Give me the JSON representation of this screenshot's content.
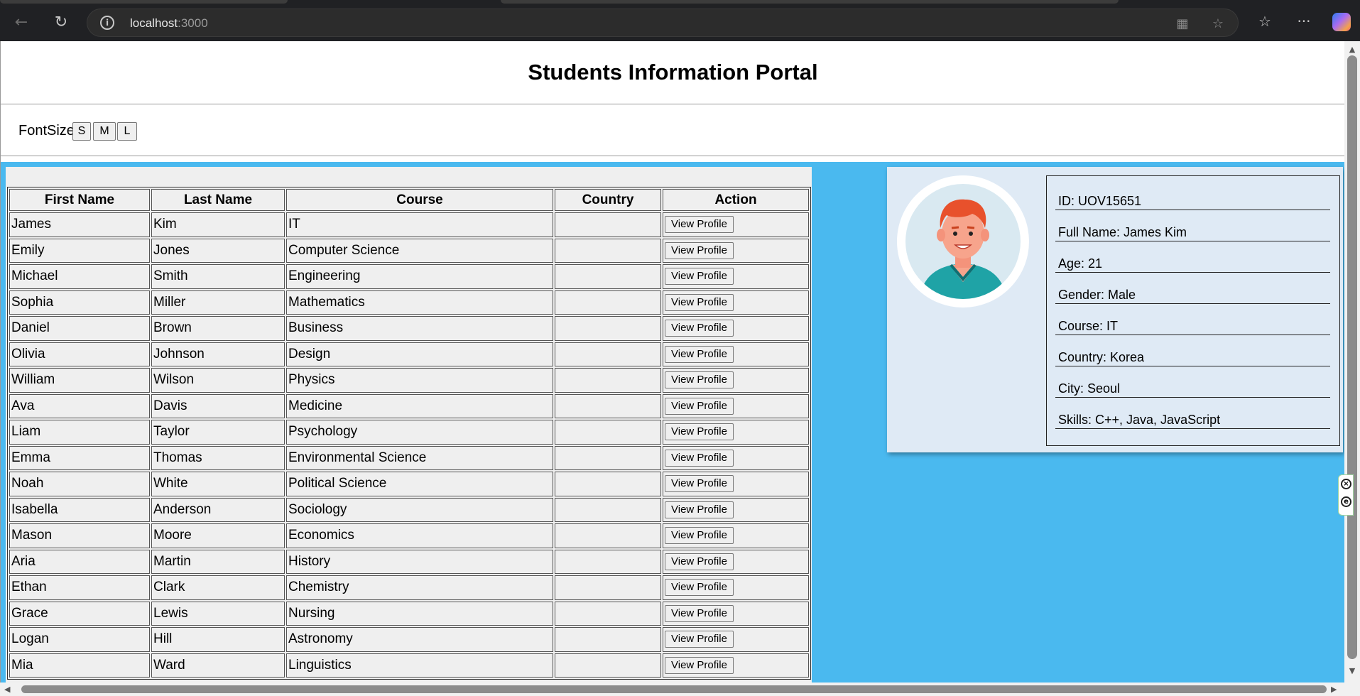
{
  "browser": {
    "url_host": "localhost",
    "url_port": ":3000"
  },
  "page": {
    "title": "Students Information Portal",
    "fontsize_label": "FontSize",
    "fontsize_buttons": [
      "S",
      "M",
      "L"
    ]
  },
  "table": {
    "headers": [
      "First Name",
      "Last Name",
      "Course",
      "Country",
      "Action"
    ],
    "action_label": "View Profile",
    "rows": [
      [
        "James",
        "Kim",
        "IT",
        ""
      ],
      [
        "Emily",
        "Jones",
        "Computer Science",
        ""
      ],
      [
        "Michael",
        "Smith",
        "Engineering",
        ""
      ],
      [
        "Sophia",
        "Miller",
        "Mathematics",
        ""
      ],
      [
        "Daniel",
        "Brown",
        "Business",
        ""
      ],
      [
        "Olivia",
        "Johnson",
        "Design",
        ""
      ],
      [
        "William",
        "Wilson",
        "Physics",
        ""
      ],
      [
        "Ava",
        "Davis",
        "Medicine",
        ""
      ],
      [
        "Liam",
        "Taylor",
        "Psychology",
        ""
      ],
      [
        "Emma",
        "Thomas",
        "Environmental Science",
        ""
      ],
      [
        "Noah",
        "White",
        "Political Science",
        ""
      ],
      [
        "Isabella",
        "Anderson",
        "Sociology",
        ""
      ],
      [
        "Mason",
        "Moore",
        "Economics",
        ""
      ],
      [
        "Aria",
        "Martin",
        "History",
        ""
      ],
      [
        "Ethan",
        "Clark",
        "Chemistry",
        ""
      ],
      [
        "Grace",
        "Lewis",
        "Nursing",
        ""
      ],
      [
        "Logan",
        "Hill",
        "Astronomy",
        ""
      ],
      [
        "Mia",
        "Ward",
        "Linguistics",
        ""
      ]
    ]
  },
  "profile": {
    "details": [
      "ID: UOV15651",
      "Full Name: James Kim",
      "Age: 21",
      "Gender: Male",
      "Course: IT",
      "Country: Korea",
      "City: Seoul",
      "Skills: C++, Java, JavaScript"
    ]
  },
  "icons": {
    "back": "back-arrow-icon",
    "reload": "reload-icon",
    "info": "site-info-icon",
    "favorite": "favorite-star-icon",
    "collections": "collections-icon",
    "more": "more-options-icon",
    "copilot": "copilot-icon",
    "avatar": "student-avatar"
  },
  "colors": {
    "content_bg": "#4ab9ef",
    "card_bg": "#dfeaf5",
    "table_bg": "#efefef"
  }
}
